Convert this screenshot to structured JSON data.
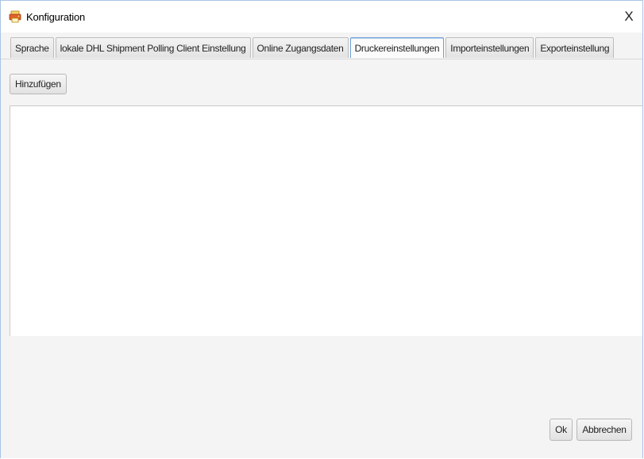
{
  "window": {
    "title": "Konfiguration",
    "app_icon": "printer-app-icon",
    "close_label": "X"
  },
  "tabs": [
    {
      "label": "Sprache",
      "active": false
    },
    {
      "label": "lokale DHL Shipment Polling Client Einstellung",
      "active": false
    },
    {
      "label": "Online Zugangsdaten",
      "active": false
    },
    {
      "label": "Druckereinstellungen",
      "active": true
    },
    {
      "label": "Importeinstellungen",
      "active": false
    },
    {
      "label": "Exporteinstellung",
      "active": false
    }
  ],
  "toolbar": {
    "add_label": "Hinzufügen"
  },
  "footer": {
    "ok_label": "Ok",
    "cancel_label": "Abbrechen"
  },
  "colors": {
    "active_tab_border": "#6fa0d8",
    "window_border": "#a9c4e3",
    "panel_background": "#f4f4f4"
  }
}
